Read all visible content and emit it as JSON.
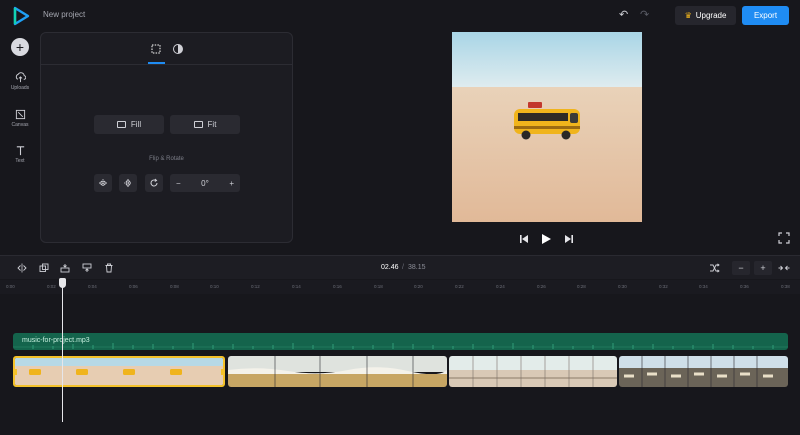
{
  "app": {
    "project_name": "New project",
    "upgrade_label": "Upgrade",
    "export_label": "Export",
    "colors": {
      "accent": "#1f8cf3",
      "audio": "#14644c",
      "selected_clip": "#f4c22a",
      "background": "#17171c"
    }
  },
  "sidebar": {
    "items": [
      {
        "label": "Uploads",
        "icon": "upload-icon"
      },
      {
        "label": "Canvas",
        "icon": "canvas-icon"
      },
      {
        "label": "Text",
        "icon": "text-icon"
      }
    ]
  },
  "panel": {
    "tabs": [
      {
        "icon": "crop-grid-icon",
        "active": true
      },
      {
        "icon": "contrast-icon",
        "active": false
      }
    ],
    "fill_label": "Fill",
    "fit_label": "Fit",
    "flip_rotate_label": "Flip & Rotate",
    "rotation_value": "0°",
    "rotation_minus": "−",
    "rotation_plus": "+"
  },
  "timeline": {
    "current_time": "02.46",
    "separator": "/",
    "total_time": "38.15",
    "ruler_ticks": [
      "0:00",
      "0:02",
      "0:04",
      "0:06",
      "0:08",
      "0:10",
      "0:12",
      "0:14",
      "0:16",
      "0:18",
      "0:20",
      "0:22",
      "0:24",
      "0:26",
      "0:28",
      "0:30",
      "0:32",
      "0:34",
      "0:36",
      "0:38"
    ],
    "audio_track_label": "music-for-project.mp3",
    "zoom_out": "−",
    "zoom_in": "+"
  }
}
